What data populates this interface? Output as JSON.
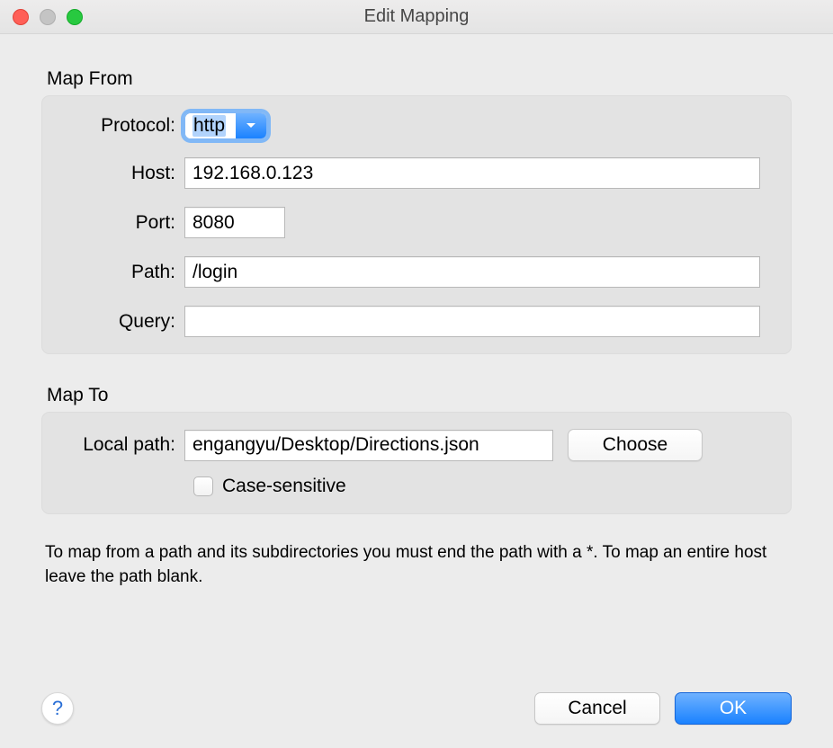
{
  "window": {
    "title": "Edit Mapping"
  },
  "mapFrom": {
    "legend": "Map From",
    "protocol_label": "Protocol:",
    "protocol_value": "http",
    "host_label": "Host:",
    "host_value": "192.168.0.123",
    "port_label": "Port:",
    "port_value": "8080",
    "path_label": "Path:",
    "path_value": "/login",
    "query_label": "Query:",
    "query_value": ""
  },
  "mapTo": {
    "legend": "Map To",
    "localpath_label": "Local path:",
    "localpath_value": "engangyu/Desktop/Directions.json",
    "choose_label": "Choose",
    "case_sensitive_label": "Case-sensitive",
    "case_sensitive_checked": false
  },
  "hint": "To map from a path and its subdirectories you must end the path with a *. To map an entire host leave the path blank.",
  "buttons": {
    "help_label": "?",
    "cancel_label": "Cancel",
    "ok_label": "OK"
  }
}
